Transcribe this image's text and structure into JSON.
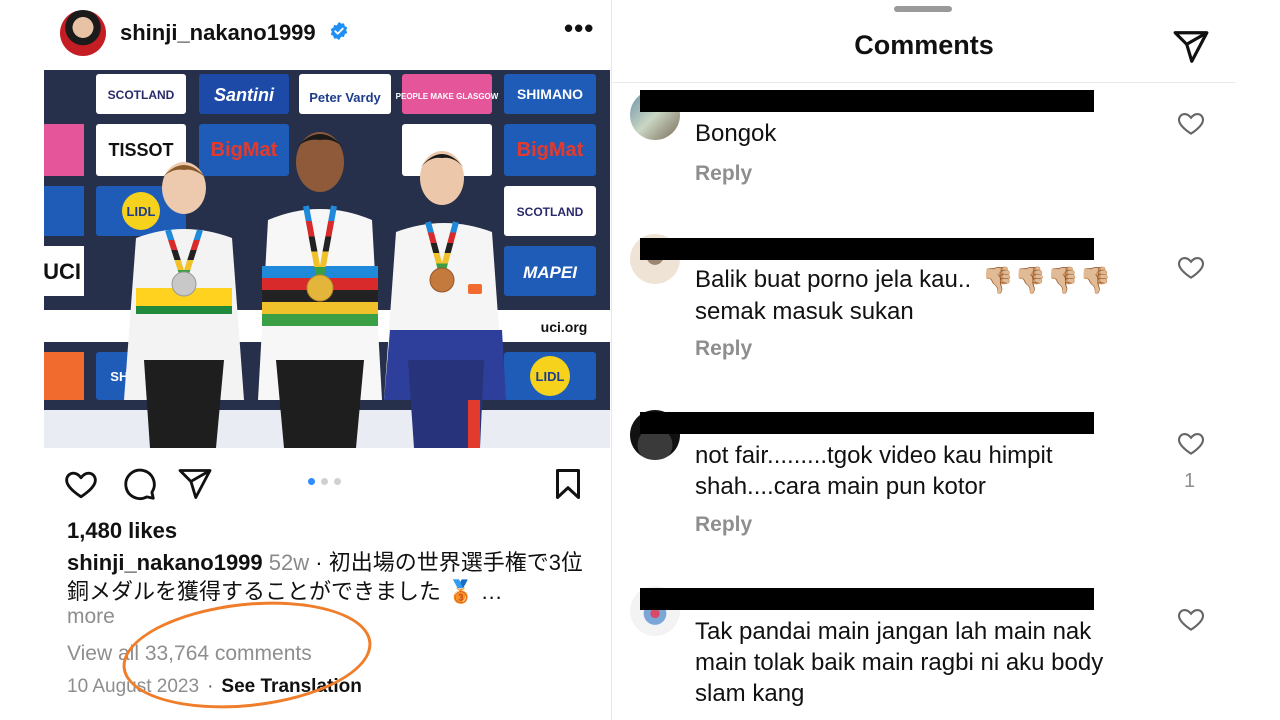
{
  "post": {
    "username": "shinji_nakano1999",
    "more_label": "•••",
    "likes": "1,480 likes",
    "caption_user": "shinji_nakano1999",
    "caption_age": "52w",
    "caption_text": " · 初出場の世界選手権で3位銅メダルを獲得することができました",
    "caption_ellipsis": " …",
    "more": "more",
    "view_all": "View all 33,764 comments",
    "date": "10 August 2023",
    "meta_sep": "·",
    "see_translation": "See Translation",
    "carousel": {
      "count": 3,
      "active": 0
    },
    "banner_text": [
      "SCOTLAND",
      "Santini",
      "Peter Vardy",
      "PEOPLE MAKE GLASGOW",
      "SHIMANO",
      "TISSOT",
      "BigMat",
      "LIDL",
      "MAPEI",
      "uci.org",
      "UCI"
    ],
    "icons": [
      "heart-icon",
      "comment-icon",
      "share-icon",
      "bookmark-icon",
      "verified-badge-icon",
      "medal-emoji-icon"
    ]
  },
  "sheet": {
    "title": "Comments",
    "icons": [
      "send-icon",
      "heart-icon"
    ],
    "comments": [
      {
        "text": "Bongok",
        "reply": "Reply",
        "likes": ""
      },
      {
        "text": "Balik buat porno jela kau..",
        "text2": "semak masuk sukan",
        "emoji": "👎🏼👎🏼👎🏼👎🏼",
        "reply": "Reply",
        "likes": ""
      },
      {
        "text": "not fair.........tgok video kau himpit",
        "text2": "shah....cara main pun kotor",
        "reply": "Reply",
        "likes": "1"
      },
      {
        "text": "Tak pandai main jangan lah main nak",
        "text2": "main tolak baik main ragbi ni aku body",
        "text3": "slam kang",
        "reply": "",
        "likes": ""
      }
    ]
  },
  "colors": {
    "accent_blue": "#2f8cff",
    "highlight_orange": "#ef7d2a",
    "muted_text": "#8e8e8e",
    "redaction": "#000000"
  }
}
